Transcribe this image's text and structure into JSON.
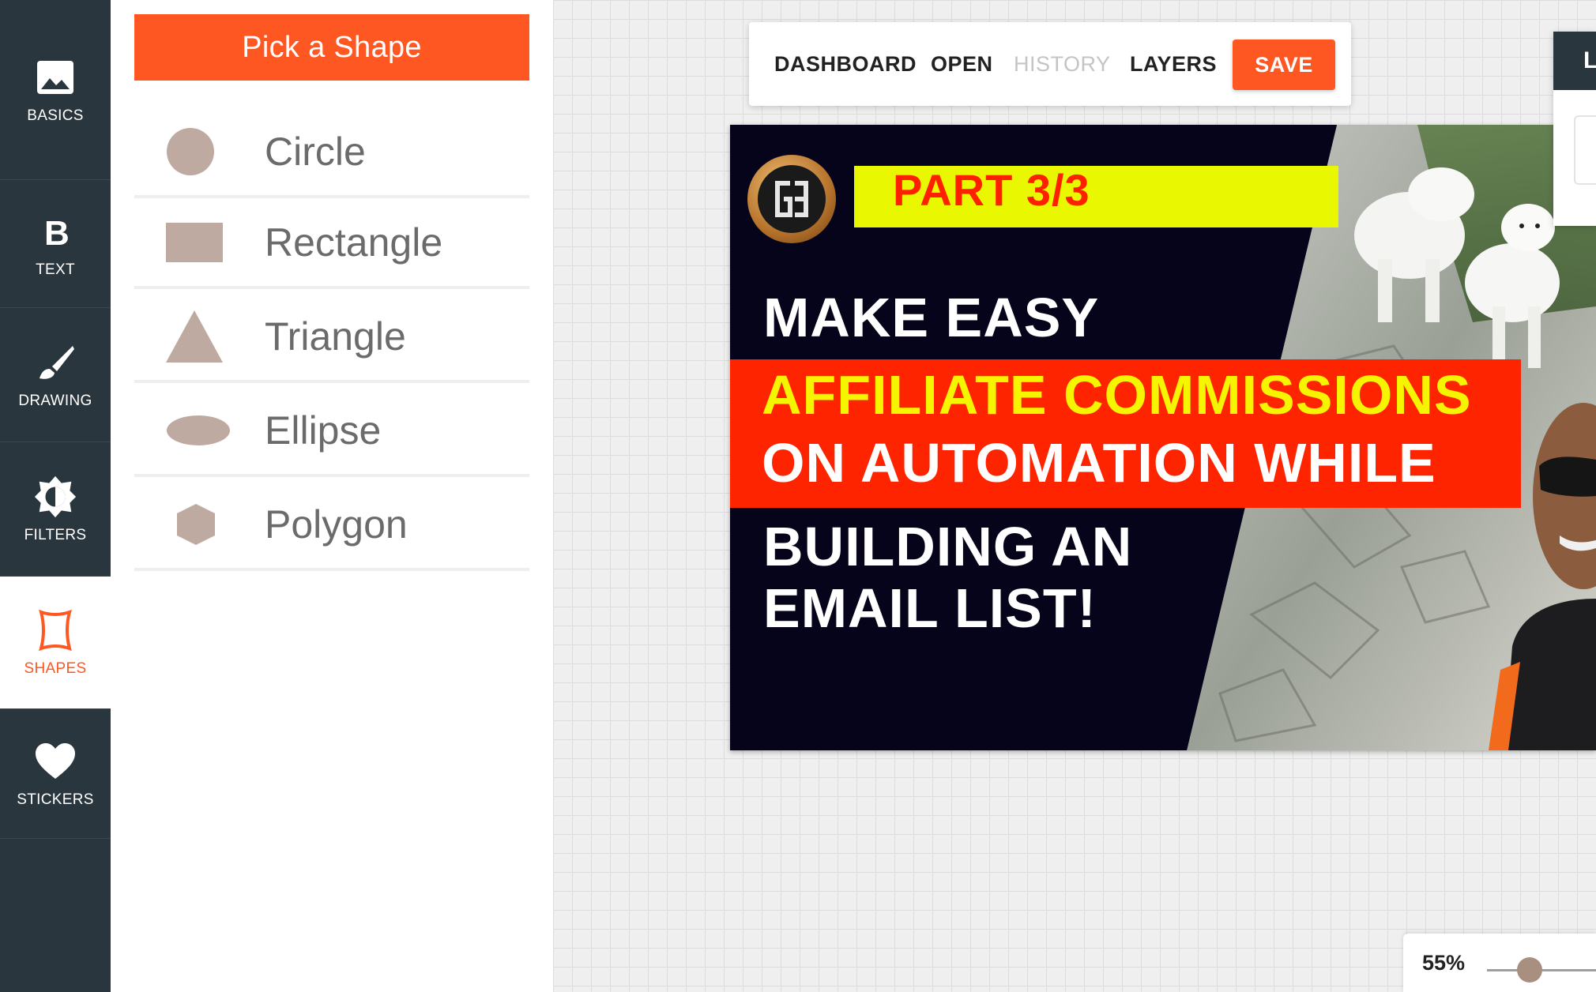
{
  "nav": {
    "items": [
      {
        "label": "BASICS",
        "icon": "image-icon",
        "active": false
      },
      {
        "label": "TEXT",
        "icon": "bold-b-icon",
        "active": false
      },
      {
        "label": "DRAWING",
        "icon": "paintbrush-icon",
        "active": false
      },
      {
        "label": "FILTERS",
        "icon": "brightness-icon",
        "active": false
      },
      {
        "label": "SHAPES",
        "icon": "shape-frame-icon",
        "active": true
      },
      {
        "label": "STICKERS",
        "icon": "heart-icon",
        "active": false
      }
    ]
  },
  "panel": {
    "title": "Pick a Shape",
    "shapes": [
      {
        "label": "Circle",
        "icon": "circle-icon"
      },
      {
        "label": "Rectangle",
        "icon": "rectangle-icon"
      },
      {
        "label": "Triangle",
        "icon": "triangle-icon"
      },
      {
        "label": "Ellipse",
        "icon": "ellipse-icon"
      },
      {
        "label": "Polygon",
        "icon": "polygon-icon"
      }
    ]
  },
  "toolbar": {
    "dashboard": "DASHBOARD",
    "open": "OPEN",
    "history": "HISTORY",
    "layers": "LAYERS",
    "save": "SAVE"
  },
  "right_panel": {
    "title": "L"
  },
  "artwork": {
    "part": "PART 3/3",
    "line1": "MAKE EASY",
    "line2": "AFFILIATE COMMISSIONS",
    "line3": "ON AUTOMATION WHILE",
    "line4": "BUILDING AN",
    "line5": "EMAIL LIST!"
  },
  "zoom": {
    "label": "55%",
    "value": 55
  },
  "colors": {
    "accent": "#ff5722",
    "nav_bg": "#2a363d",
    "shape_fill": "#bfaaa2",
    "banner_yellow": "#e9f700",
    "banner_red": "#ff2400"
  }
}
